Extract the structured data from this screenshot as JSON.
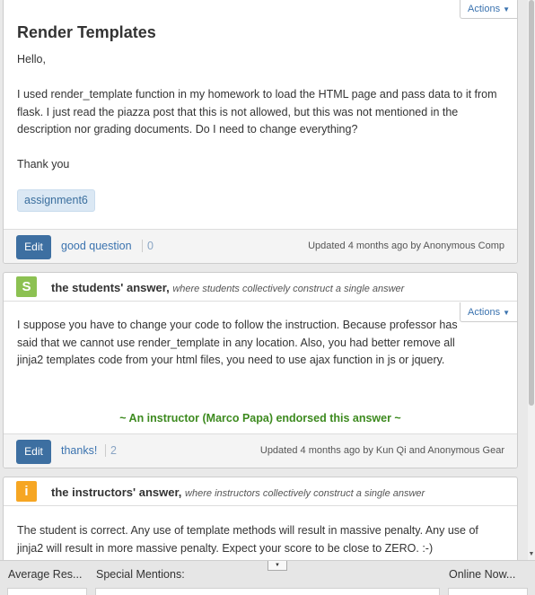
{
  "question": {
    "actions_label": "Actions",
    "title": "Render Templates",
    "body": [
      "Hello,",
      "I used render_template function in my homework to load the HTML page and pass data to it from flask. I just read the piazza post that this is not allowed, but this was not mentioned in the description nor grading documents. Do I need to change everything?",
      "Thank you"
    ],
    "tag": "assignment6",
    "edit_label": "Edit",
    "good_label": "good question",
    "good_count": "0",
    "updated": "Updated 4 months ago by Anonymous Comp"
  },
  "student_answer": {
    "icon_letter": "S",
    "icon_color": "#8cc152",
    "title": "the students' answer,",
    "subtitle": "where students collectively construct a single answer",
    "actions_label": "Actions",
    "body": "I suppose you have to change your code to follow the instruction. Because professor has said that we cannot use render_template in any location. Also, you had better remove all jinja2 templates code from your html files, you need to use ajax function in js or jquery.",
    "endorsement": "~ An instructor (Marco Papa) endorsed this answer ~",
    "edit_label": "Edit",
    "thanks_label": "thanks!",
    "thanks_count": "2",
    "updated": "Updated 4 months ago by Kun Qi and Anonymous Gear"
  },
  "instructor_answer": {
    "icon_letter": "i",
    "icon_color": "#f6a623",
    "title": "the instructors' answer,",
    "subtitle": "where instructors collectively construct a single answer",
    "body": "The student is correct. Any use of template methods will result in massive penalty. Any use of jinja2 will result in more massive penalty. Expect your score to be close to ZERO. :-)"
  },
  "bottom_bar": {
    "average_label": "Average Res...",
    "special_label": "Special Mentions:",
    "online_label": "Online Now..."
  }
}
